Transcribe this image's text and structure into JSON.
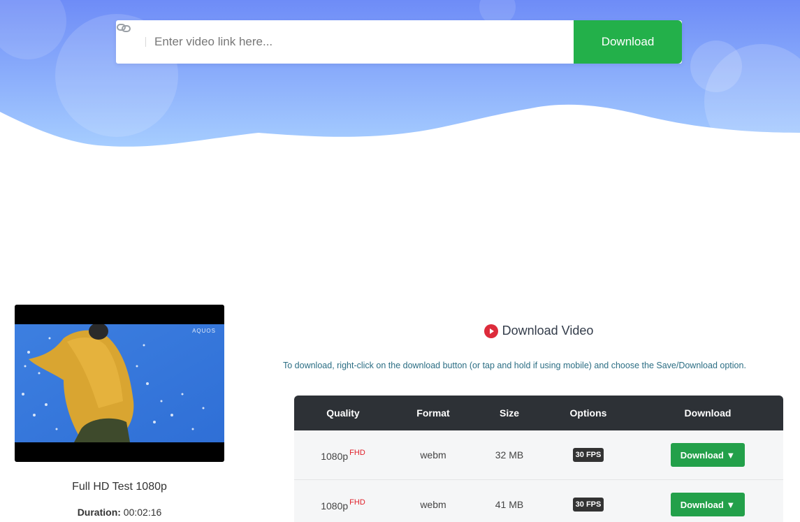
{
  "colors": {
    "hero_top": "#6e8cf7",
    "hero_bottom": "#9ec8ff",
    "accent_green": "#23b04a",
    "table_header": "#2d3136",
    "badge_red": "#e0202a",
    "play_red": "#dd2b3b",
    "instruction_text": "#2c6e84"
  },
  "search": {
    "placeholder": "Enter video link here...",
    "button_label": "Download",
    "icon": "link-icon"
  },
  "video": {
    "brand_mark": "AQUOS",
    "title": "Full HD Test 1080p",
    "duration_label": "Duration:",
    "duration_value": "00:02:16"
  },
  "section": {
    "icon": "play-circle-icon",
    "heading": "Download Video",
    "instructions": "To download, right-click on the download button (or tap and hold if using mobile) and choose the Save/Download option."
  },
  "table": {
    "headers": [
      "Quality",
      "Format",
      "Size",
      "Options",
      "Download"
    ],
    "rows": [
      {
        "quality": "1080p",
        "badge": "FHD",
        "format": "webm",
        "size": "32 MB",
        "option": "30 FPS",
        "download": "Download ▼"
      },
      {
        "quality": "1080p",
        "badge": "FHD",
        "format": "webm",
        "size": "41 MB",
        "option": "30 FPS",
        "download": "Download ▼"
      }
    ]
  }
}
